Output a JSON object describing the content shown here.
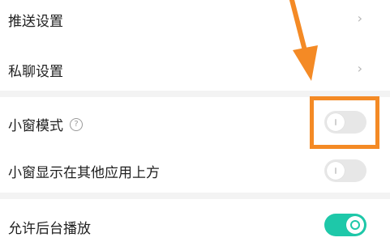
{
  "settings": {
    "push_settings": {
      "label": "推送设置",
      "chevron": "›"
    },
    "private_chat_settings": {
      "label": "私聊设置",
      "chevron": "›"
    },
    "small_window_mode": {
      "label": "小窗模式",
      "help_icon": "?",
      "enabled": false
    },
    "small_window_on_top": {
      "label": "小窗显示在其他应用上方",
      "enabled": false
    },
    "background_playback": {
      "label": "允许后台播放",
      "enabled": true
    }
  },
  "annotation": {
    "color": "#f48a25",
    "arrow_icon": "arrow-down-icon",
    "highlight": "highlight-box"
  },
  "colors": {
    "toggle_on": "#1ec8a9",
    "toggle_off": "#e7e7e7",
    "divider": "#f3f3f3"
  }
}
